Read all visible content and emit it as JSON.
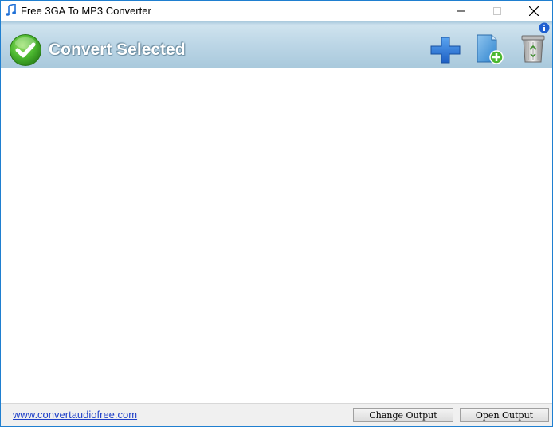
{
  "window": {
    "title": "Free 3GA To MP3 Converter"
  },
  "toolbar": {
    "convert_label": "Convert Selected",
    "add_icon": "plus-icon",
    "add_folder_icon": "add-folder-icon",
    "delete_icon": "recycle-bin-icon",
    "info_icon": "info-icon"
  },
  "statusbar": {
    "link_text": "www.convertaudiofree.com",
    "change_output_label": "Change Output",
    "open_output_label": "Open Output"
  },
  "colors": {
    "window_border": "#1f7fd0",
    "toolbar_blue": "#bcd6e6",
    "link": "#1e3fc8",
    "accent_green": "#4cb830",
    "add_blue": "#1e6fd6"
  }
}
